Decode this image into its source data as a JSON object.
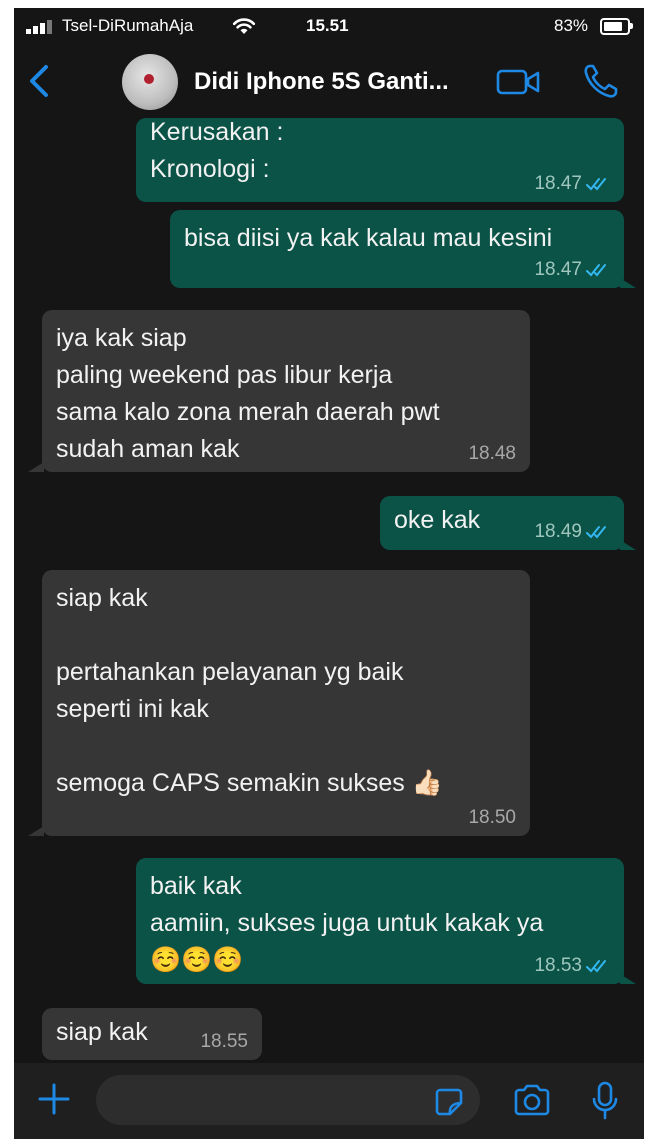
{
  "status_bar": {
    "carrier": "Tsel-DiRumahAja",
    "time": "15.51",
    "battery": "83%",
    "battery_level": 0.83
  },
  "header": {
    "contact_name": "Didi Iphone 5S Ganti...",
    "icons": [
      "back-chevron-icon",
      "avatar",
      "video-call-icon",
      "voice-call-icon"
    ]
  },
  "messages": [
    {
      "dir": "out",
      "text": "Kerusakan :\nKronologi :",
      "time": "18.47",
      "status": "read"
    },
    {
      "dir": "out",
      "text": "bisa diisi ya kak kalau mau kesini",
      "time": "18.47",
      "status": "read"
    },
    {
      "dir": "in",
      "text": "iya kak siap\npaling weekend pas libur kerja\nsama kalo zona merah daerah pwt\nsudah aman kak",
      "time": "18.48"
    },
    {
      "dir": "out",
      "text": "oke kak",
      "time": "18.49",
      "status": "read"
    },
    {
      "dir": "in",
      "text": "siap kak\n\npertahankan pelayanan yg baik\nseperti ini kak\n\nsemoga CAPS semakin sukses 👍🏻",
      "time": "18.50"
    },
    {
      "dir": "out",
      "text": "baik kak\naamiin, sukses juga untuk kakak ya\n☺️☺️☺️",
      "time": "18.53",
      "status": "read"
    },
    {
      "dir": "in",
      "text": "siap kak",
      "time": "18.55"
    }
  ],
  "input_bar": {
    "icons": [
      "plus-icon",
      "sticker-icon",
      "camera-icon",
      "microphone-icon"
    ]
  },
  "colors": {
    "outgoing_bubble": "#0b5247",
    "incoming_bubble": "#363636",
    "accent_blue": "#1e88e5",
    "read_tick": "#34b7f1"
  }
}
